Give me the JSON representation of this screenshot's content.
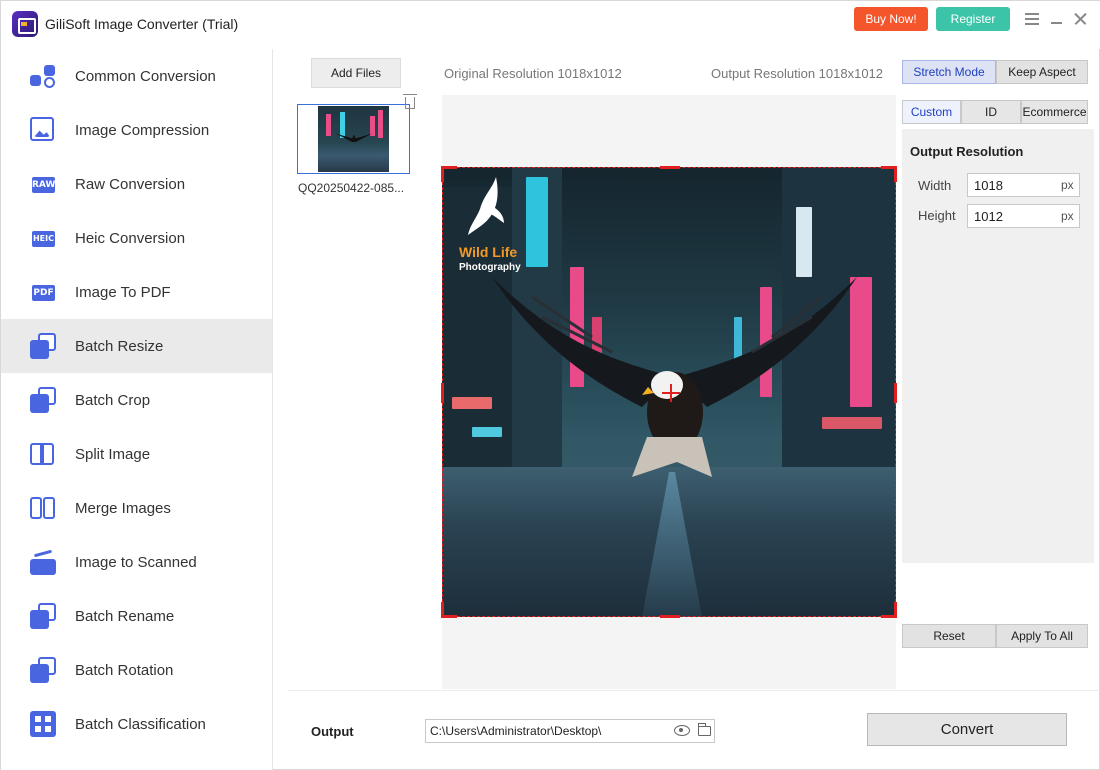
{
  "app": {
    "title": "GiliSoft Image Converter (Trial)"
  },
  "titlebar": {
    "buy_label": "Buy Now!",
    "register_label": "Register"
  },
  "colors": {
    "accent": "#4966e0",
    "buy": "#f4552a",
    "register": "#3cc4a8",
    "crop": "#e02020"
  },
  "sidebar": {
    "items": [
      {
        "label": "Common Conversion",
        "icon": "convert-icon"
      },
      {
        "label": "Image Compression",
        "icon": "compress-icon"
      },
      {
        "label": "Raw Conversion",
        "icon": "raw-icon",
        "badge": "RAW"
      },
      {
        "label": "Heic Conversion",
        "icon": "heic-icon",
        "badge": "HEIC"
      },
      {
        "label": "Image To PDF",
        "icon": "pdf-icon",
        "badge": "PDF"
      },
      {
        "label": "Batch Resize",
        "icon": "resize-icon",
        "active": true
      },
      {
        "label": "Batch Crop",
        "icon": "crop-icon"
      },
      {
        "label": "Split Image",
        "icon": "split-icon"
      },
      {
        "label": "Merge Images",
        "icon": "merge-icon"
      },
      {
        "label": "Image to Scanned",
        "icon": "scanner-icon"
      },
      {
        "label": "Batch Rename",
        "icon": "rename-icon"
      },
      {
        "label": "Batch Rotation",
        "icon": "rotate-icon"
      },
      {
        "label": "Batch Classification",
        "icon": "classify-icon"
      }
    ]
  },
  "toolbar": {
    "add_files_label": "Add Files",
    "original_resolution": "Original Resolution 1018x1012",
    "output_resolution": "Output Resolution 1018x1012"
  },
  "files": [
    {
      "name": "QQ20250422-085..."
    }
  ],
  "preview": {
    "logo_line1": "Wild Life",
    "logo_line2": "Photography"
  },
  "modes": {
    "stretch_label": "Stretch Mode",
    "keep_label": "Keep Aspect"
  },
  "subtabs": {
    "custom_label": "Custom",
    "id_label": "ID",
    "ecommerce_label": "Ecommerce"
  },
  "settings": {
    "title": "Output Resolution",
    "width_label": "Width",
    "width_value": "1018",
    "height_label": "Height",
    "height_value": "1012",
    "unit": "px"
  },
  "actions": {
    "reset_label": "Reset",
    "apply_all_label": "Apply To All"
  },
  "output": {
    "label": "Output",
    "path": "C:\\Users\\Administrator\\Desktop\\",
    "convert_label": "Convert"
  }
}
